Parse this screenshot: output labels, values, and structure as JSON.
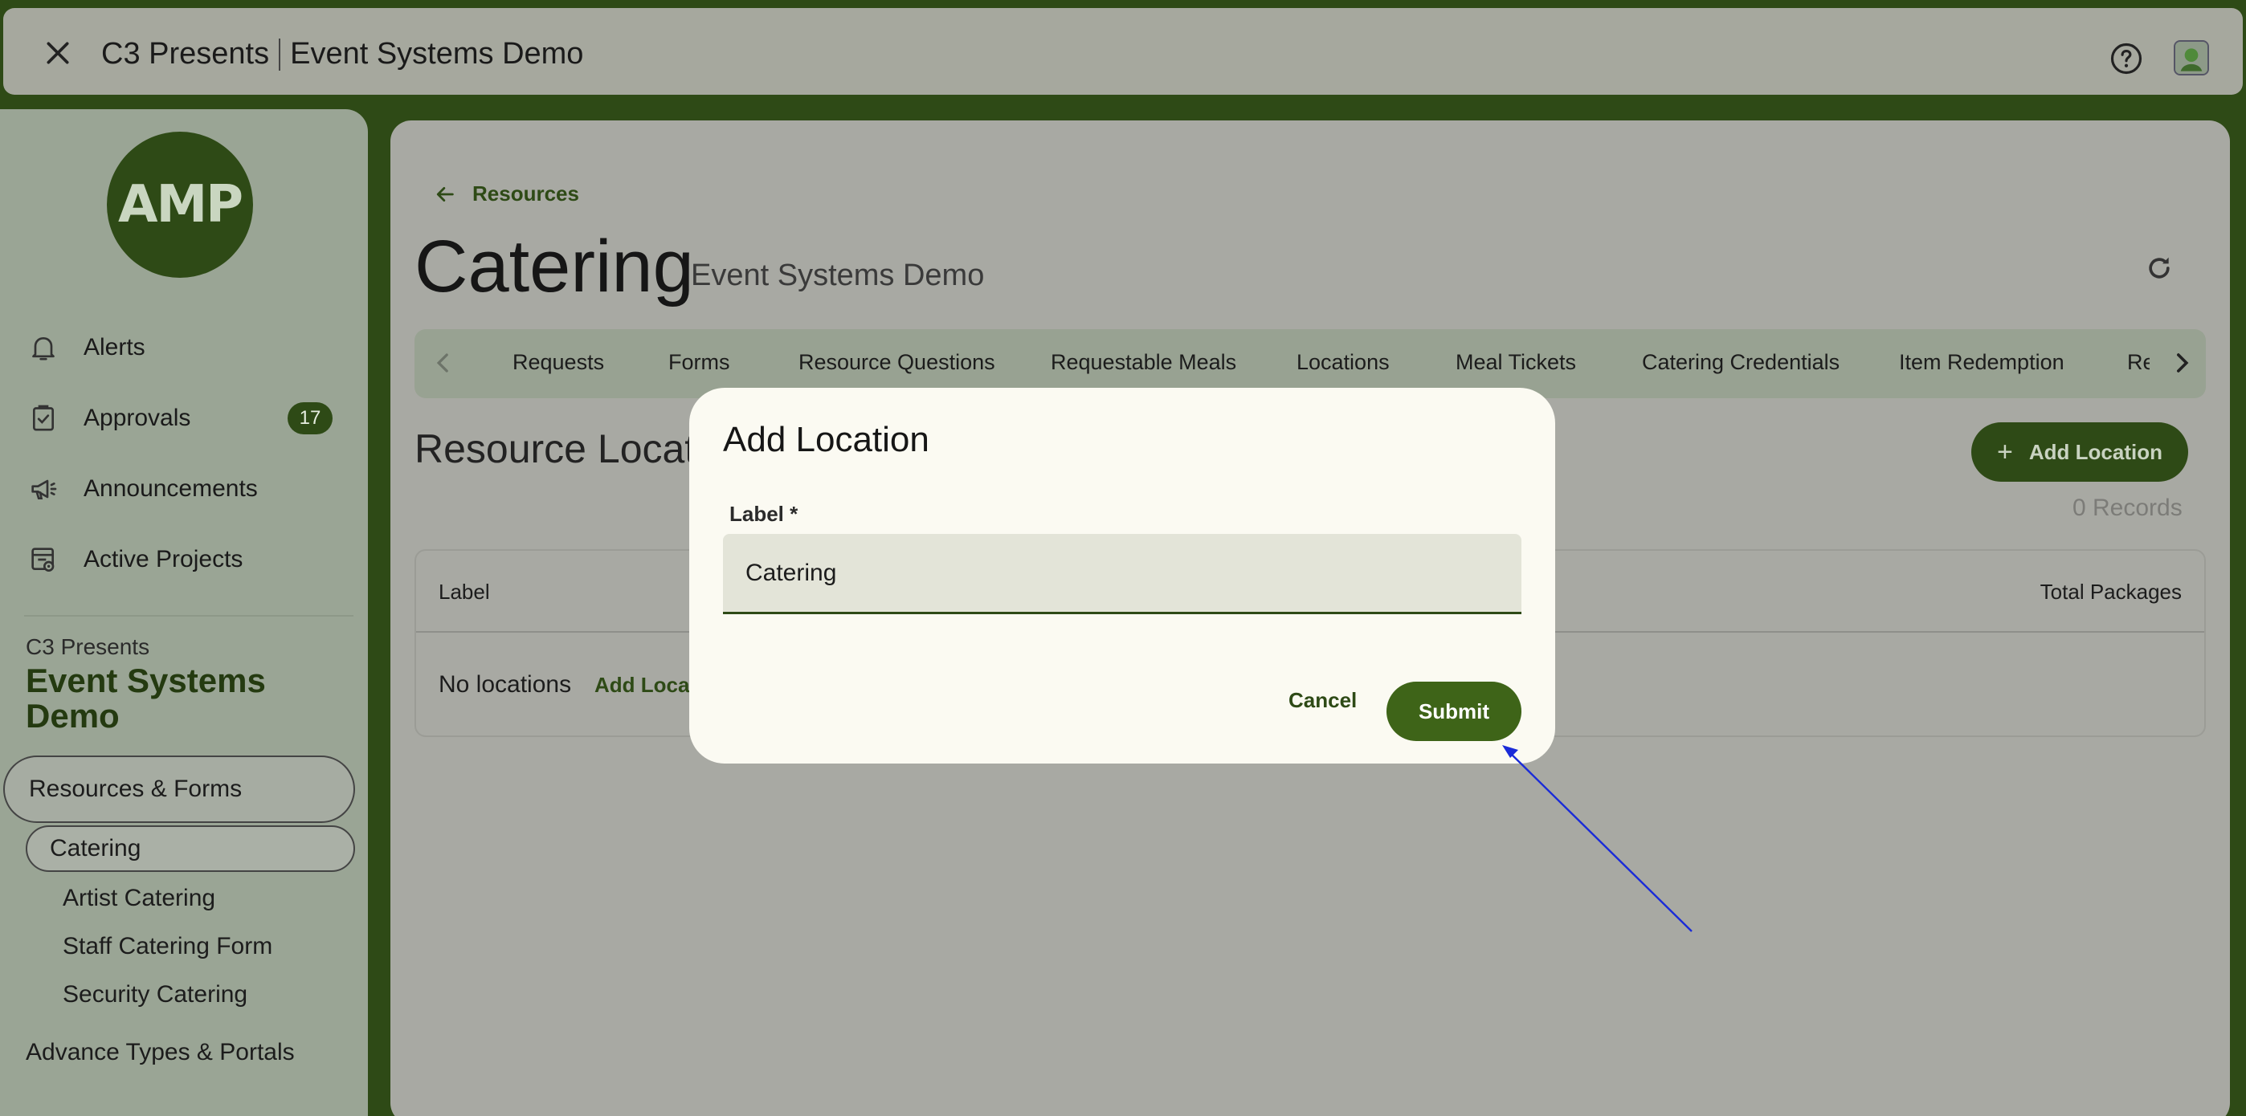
{
  "header": {
    "org": "C3 Presents",
    "event": "Event Systems Demo"
  },
  "sidebar": {
    "logo_text": "AMP",
    "nav": [
      {
        "label": "Alerts",
        "icon": "bell-icon"
      },
      {
        "label": "Approvals",
        "icon": "clipboard-check-icon",
        "badge": "17"
      },
      {
        "label": "Announcements",
        "icon": "megaphone-icon"
      },
      {
        "label": "Active Projects",
        "icon": "project-icon"
      }
    ],
    "org_name": "C3 Presents",
    "event_name": "Event Systems Demo",
    "section_resources": "Resources & Forms",
    "active_item": "Catering",
    "sub_items": [
      "Artist Catering",
      "Staff Catering Form",
      "Security Catering"
    ],
    "section_advance": "Advance Types & Portals"
  },
  "main": {
    "back_label": "Resources",
    "title": "Catering",
    "subtitle": "Event Systems Demo",
    "tabs": [
      "Requests",
      "Forms",
      "Resource Questions",
      "Requestable Meals",
      "Locations",
      "Meal Tickets",
      "Catering Credentials",
      "Item Redemption",
      "Re"
    ],
    "section_title": "Resource Locat",
    "add_button": "Add Location",
    "records": "0 Records",
    "table": {
      "col_label": "Label",
      "col_total": "Total Packages",
      "empty_text": "No locations",
      "empty_link": "Add Locat"
    }
  },
  "dialog": {
    "title": "Add Location",
    "field_label": "Label *",
    "field_value": "Catering",
    "cancel": "Cancel",
    "submit": "Submit"
  },
  "colors": {
    "brand": "#2e4a16",
    "submit": "#3e6418",
    "annotation_arrow": "#1a2bd8"
  }
}
